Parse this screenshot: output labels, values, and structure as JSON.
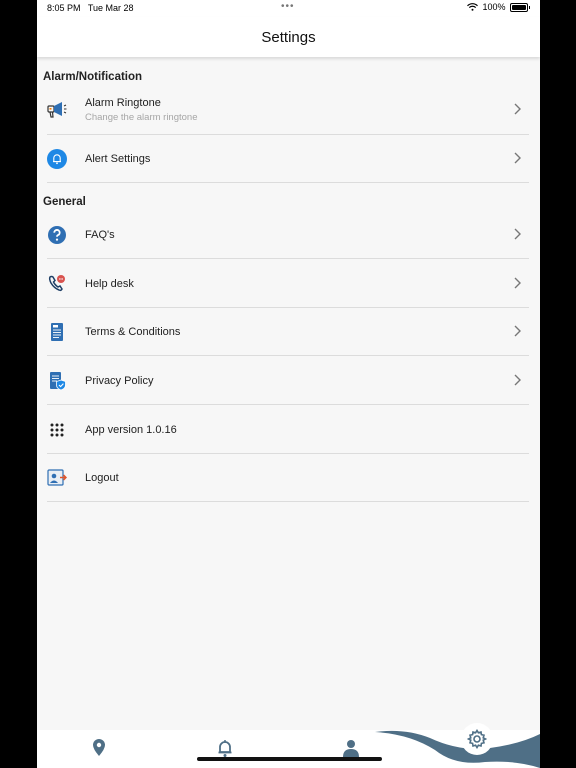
{
  "status_bar": {
    "time": "8:05 PM",
    "date": "Tue Mar 28",
    "battery": "100%"
  },
  "header": {
    "title": "Settings"
  },
  "sections": [
    {
      "title": "Alarm/Notification",
      "items": [
        {
          "label": "Alarm Ringtone",
          "subtitle": "Change the alarm ringtone",
          "icon": "megaphone-icon"
        },
        {
          "label": "Alert Settings",
          "icon": "bell-circle-icon"
        }
      ]
    },
    {
      "title": "General",
      "items": [
        {
          "label": "FAQ's",
          "icon": "question-circle-icon"
        },
        {
          "label": "Help desk",
          "icon": "phone-chat-icon"
        },
        {
          "label": "Terms & Conditions",
          "icon": "document-icon"
        },
        {
          "label": "Privacy Policy",
          "icon": "shield-document-icon"
        },
        {
          "label": "App version 1.0.16",
          "icon": "dots-grid-icon"
        },
        {
          "label": "Logout",
          "icon": "logout-icon"
        }
      ]
    }
  ],
  "tab_bar": {
    "tabs": [
      {
        "name": "location",
        "icon": "location-pin-icon"
      },
      {
        "name": "alerts",
        "icon": "bell-icon"
      },
      {
        "name": "profile",
        "icon": "person-icon"
      },
      {
        "name": "settings",
        "icon": "gear-icon",
        "active": true
      }
    ]
  },
  "colors": {
    "accent": "#2f6fb3",
    "icon_blue": "#1e88e5",
    "wave": "#4f6f86"
  }
}
